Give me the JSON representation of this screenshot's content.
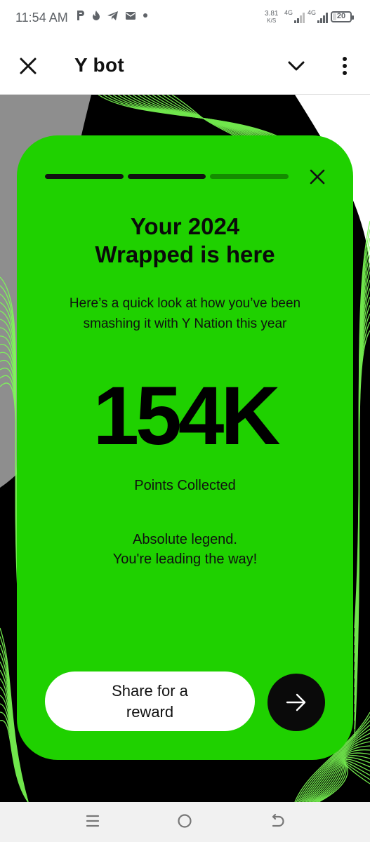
{
  "status_bar": {
    "time": "11:54 AM",
    "speed_value": "3.81",
    "speed_unit": "K/S",
    "network1": "4G",
    "network2": "4G",
    "battery": "20",
    "battery_fraction": 0.2,
    "icons": [
      "p-app-icon",
      "flame-icon",
      "telegram-icon",
      "mail-icon",
      "dot-icon"
    ]
  },
  "header": {
    "title": "Y bot",
    "close_icon": "close-icon",
    "chevron_icon": "chevron-down-icon",
    "more_icon": "more-vertical-icon"
  },
  "story": {
    "progress": [
      1,
      1,
      0
    ],
    "title_lines": [
      "Your 2024",
      "Wrapped is here"
    ],
    "subtitle_lines": [
      "Here’s a quick look at how you’ve been",
      "smashing it with Y Nation this year"
    ],
    "metric_value": "154K",
    "metric_label": "Points Collected",
    "message_lines": [
      "Absolute legend.",
      "You're leading the way!"
    ],
    "share_lines": [
      "Share for a",
      "reward"
    ],
    "next_icon": "arrow-right-icon"
  },
  "colors": {
    "card": "#1fd100",
    "progress_done": "#111111",
    "progress_todo": "#148c00",
    "accent_lines": "#7dff55"
  },
  "nav_bar": {
    "icons": [
      "recents-icon",
      "home-icon",
      "back-icon"
    ]
  }
}
